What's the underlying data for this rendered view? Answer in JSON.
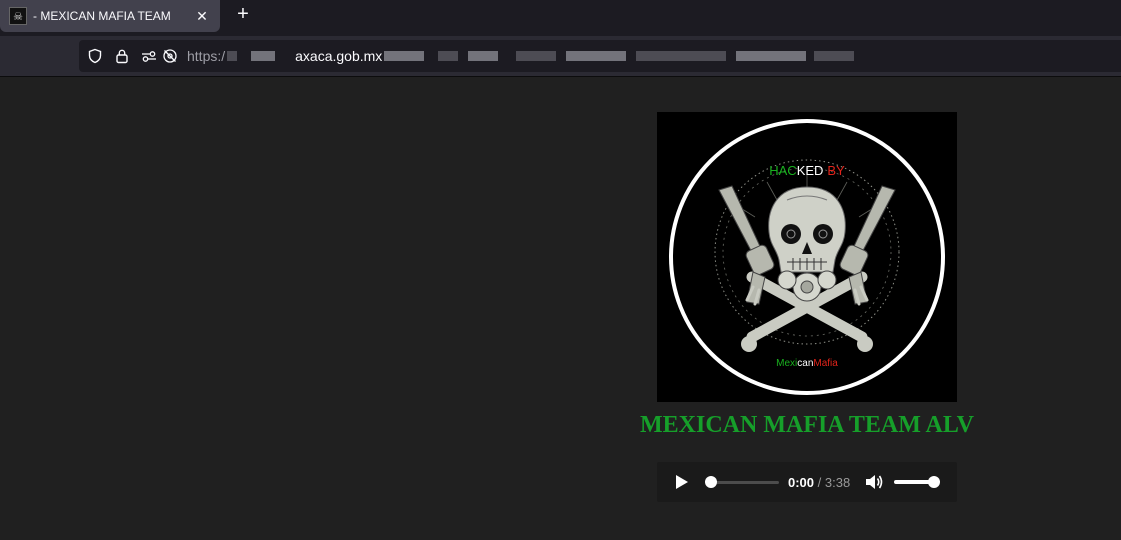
{
  "browser": {
    "tab": {
      "title": "- MEXICAN MAFIA TEAM",
      "close_glyph": "✕",
      "favicon": "skull-favicon"
    },
    "new_tab_glyph": "+",
    "url": {
      "scheme": "https:/",
      "host_visible": "axaca.gob.mx"
    },
    "icons": [
      "shield-icon",
      "lock-icon",
      "permissions-icon",
      "tracking-off-icon"
    ]
  },
  "page": {
    "image": {
      "top_text_part1": "HAC",
      "top_text_part2": "KED",
      "top_text_part3": "BY",
      "bottom_text_part1": "Mexi",
      "bottom_text_part2": "can",
      "bottom_text_part3": "Mafia",
      "colors": {
        "green": "#19b11f",
        "white": "#ffffff",
        "red": "#e2231a"
      }
    },
    "heading": "MEXICAN MAFIA TEAM ALV",
    "heading_color": "#169f2a",
    "audio": {
      "current_time": "0:00",
      "separator": "/",
      "duration": "3:38",
      "progress": 0,
      "volume": 1
    }
  }
}
